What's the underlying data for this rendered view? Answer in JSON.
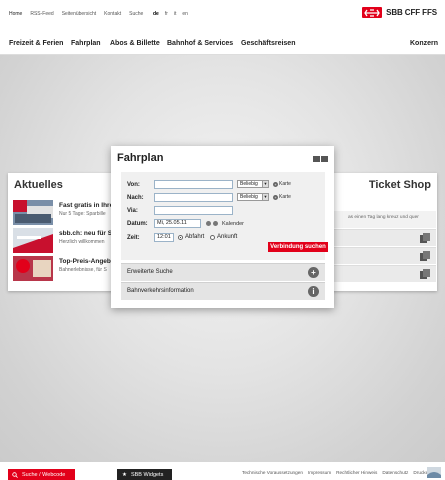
{
  "topbar": {
    "links": [
      "Home",
      "RSS-Feed",
      "Seitenübersicht",
      "Kontakt",
      "Suche"
    ],
    "languages": [
      "de",
      "fr",
      "it",
      "en"
    ],
    "active_language": "de"
  },
  "brand": {
    "wordmark": "SBB CFF FFS",
    "color": "#e2001a"
  },
  "mainnav": {
    "items": [
      "Freizeit & Ferien",
      "Fahrplan",
      "Abos & Billette",
      "Bahnhof & Services",
      "Geschäftsreisen"
    ],
    "right_item": "Konzern"
  },
  "aktuelles": {
    "title": "Aktuelles",
    "items": [
      {
        "title": "Fast gratis in Ihre",
        "subtitle": "Nur 5 Tage: Sparbille"
      },
      {
        "title": "sbb.ch: neu für S",
        "subtitle": "Herzlich willkommen"
      },
      {
        "title": "Top-Preis-Angebo",
        "subtitle": "Bahnerlebnisse, für S"
      }
    ]
  },
  "ticketshop": {
    "title": "Ticket Shop",
    "subtitle": "as einen Tag lang kreuz und quer",
    "rows": 3
  },
  "fahrplan": {
    "title": "Fahrplan",
    "von_label": "Von:",
    "nach_label": "Nach:",
    "via_label": "Via:",
    "datum_label": "Datum:",
    "zeit_label": "Zeit:",
    "von_value": "",
    "nach_value": "",
    "via_value": "",
    "datum_value": "Mi, 25.05.11",
    "zeit_value": "12:01",
    "select_value": "Beliebig",
    "karte_label": "Karte",
    "kalender_label": "Kalender",
    "abfahrt_label": "Abfahrt",
    "ankunft_label": "Ankunft",
    "selected_mode": "Abfahrt",
    "submit_label": "Verbindung suchen",
    "erweiterte_label": "Erweiterte Suche",
    "info_label": "Bahnverkehrsinformation"
  },
  "footer": {
    "suche_label": "Suche / Webcode",
    "widgets_label": "SBB Widgets",
    "links": [
      "Technische Voraussetzungen",
      "Impressum",
      "Rechtlicher Hinweis",
      "Datenschutz",
      "Drucken"
    ]
  }
}
